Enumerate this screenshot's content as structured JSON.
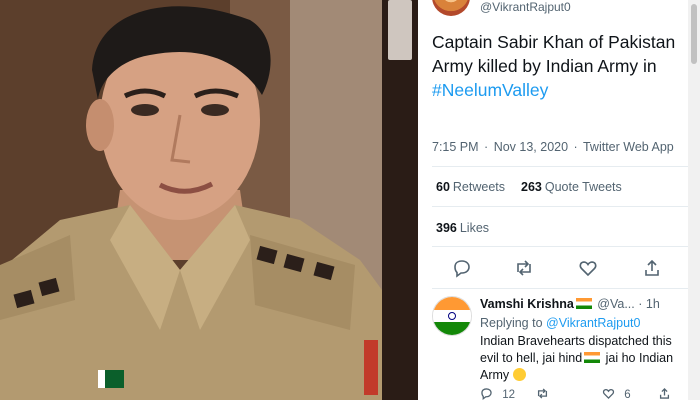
{
  "tweet": {
    "handle": "@VikrantRajput0",
    "text_plain": "Captain Sabir Khan of Pakistan Army killed by Indian Army in",
    "hashtag": "#NeelumValley",
    "time": "7:15 PM",
    "date": "Nov 13, 2020",
    "source": "Twitter Web App",
    "retweets_count": "60",
    "retweets_label": "Retweets",
    "quote_count": "263",
    "quote_label": "Quote Tweets",
    "likes_count": "396",
    "likes_label": "Likes",
    "icons": [
      "reply-icon",
      "retweet-icon",
      "like-icon",
      "share-icon"
    ]
  },
  "reply": {
    "name": "Vamshi Krishna",
    "handle": "@Va...",
    "time": "1h",
    "replying_prefix": "Replying to",
    "replying_to": "@VikrantRajput0",
    "text_line1": "Indian Bravehearts dispatched this",
    "text_line2a": "evil to hell, jai hind",
    "text_line2b": " jai ho Indian",
    "text_line3": "Army",
    "reply_count": "12",
    "like_count": "6"
  },
  "colors": {
    "link": "#1d9bf0",
    "secondary_text": "#536471",
    "primary_text": "#0f1419"
  }
}
